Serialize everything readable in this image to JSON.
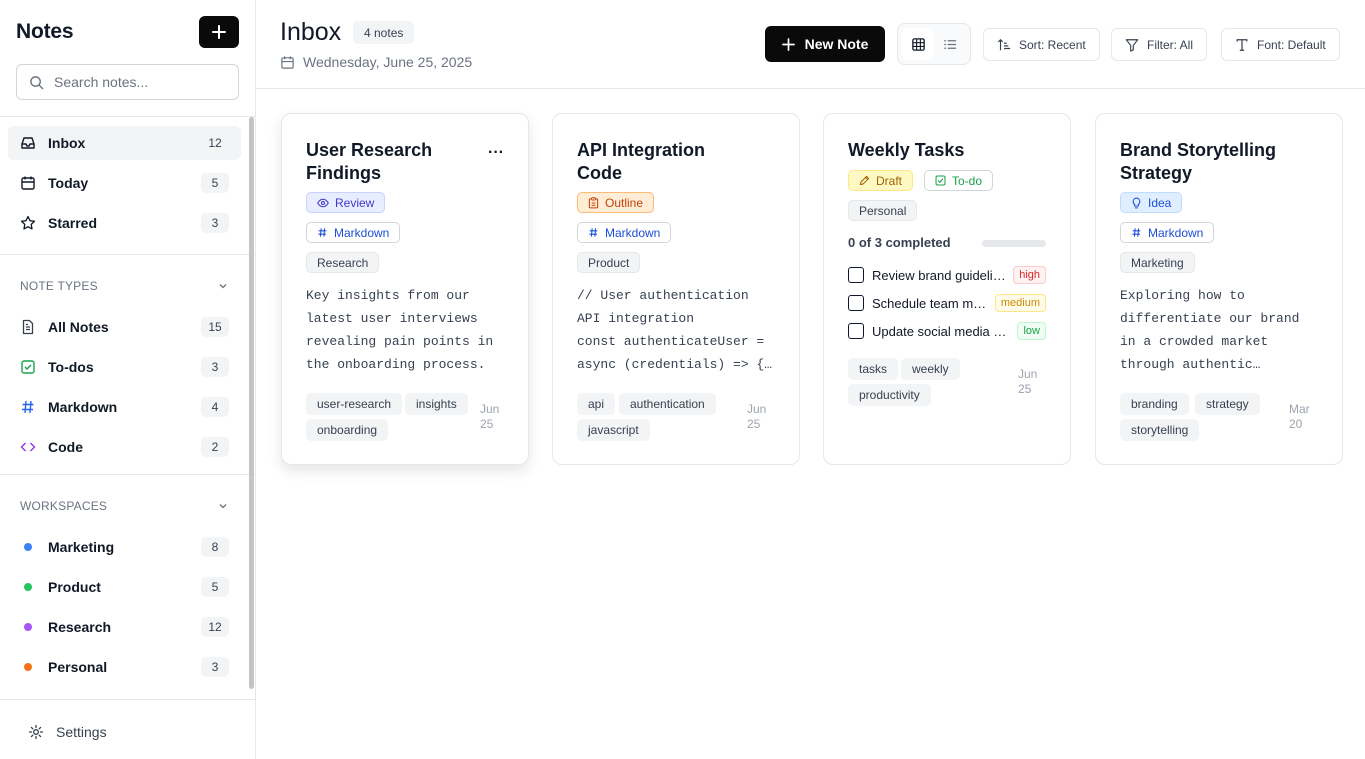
{
  "sidebar": {
    "title": "Notes",
    "search_placeholder": "Search notes...",
    "main_nav": [
      {
        "label": "Inbox",
        "count": "12"
      },
      {
        "label": "Today",
        "count": "5"
      },
      {
        "label": "Starred",
        "count": "3"
      }
    ],
    "note_types_heading": "NOTE TYPES",
    "note_types": [
      {
        "label": "All Notes",
        "count": "15"
      },
      {
        "label": "To-dos",
        "count": "3"
      },
      {
        "label": "Markdown",
        "count": "4"
      },
      {
        "label": "Code",
        "count": "2"
      }
    ],
    "workspaces_heading": "WORKSPACES",
    "workspaces": [
      {
        "label": "Marketing",
        "count": "8",
        "color": "#3b82f6"
      },
      {
        "label": "Product",
        "count": "5",
        "color": "#22c55e"
      },
      {
        "label": "Research",
        "count": "12",
        "color": "#a855f7"
      },
      {
        "label": "Personal",
        "count": "3",
        "color": "#f97316"
      }
    ],
    "settings_label": "Settings"
  },
  "header": {
    "title": "Inbox",
    "note_count": "4 notes",
    "date": "Wednesday, June 25, 2025",
    "new_note_label": "New Note",
    "sort_label": "Sort: Recent",
    "filter_label": "Filter: All",
    "font_label": "Font: Default"
  },
  "cards": [
    {
      "title": "User Research Findings",
      "status": "Review",
      "format": "Markdown",
      "workspace": "Research",
      "body": "Key insights from our latest user interviews revealing pain points in the onboarding process.",
      "tags": [
        "user-research",
        "insights",
        "onboarding"
      ],
      "date": "Jun 25"
    },
    {
      "title": "API Integration Code",
      "status": "Outline",
      "format": "Markdown",
      "workspace": "Product",
      "body": "// User authentication API integration\nconst authenticateUser = async (credentials) => {…",
      "tags": [
        "api",
        "authentication",
        "javascript"
      ],
      "date": "Jun 25"
    },
    {
      "title": "Weekly Tasks",
      "status": "Draft",
      "type": "To-do",
      "workspace": "Personal",
      "progress_text": "0 of 3 completed",
      "progress": 0,
      "todos": [
        {
          "text": "Review brand guidelines",
          "priority": "high"
        },
        {
          "text": "Schedule team meeting",
          "priority": "medium"
        },
        {
          "text": "Update social media calendar",
          "priority": "low"
        }
      ],
      "tags": [
        "tasks",
        "weekly",
        "productivity"
      ],
      "date": "Jun 25"
    },
    {
      "title": "Brand Storytelling Strategy",
      "status": "Idea",
      "format": "Markdown",
      "workspace": "Marketing",
      "body": "Exploring how to differentiate our brand in a crowded market through authentic…",
      "tags": [
        "branding",
        "strategy",
        "storytelling"
      ],
      "date": "Mar 20"
    }
  ]
}
